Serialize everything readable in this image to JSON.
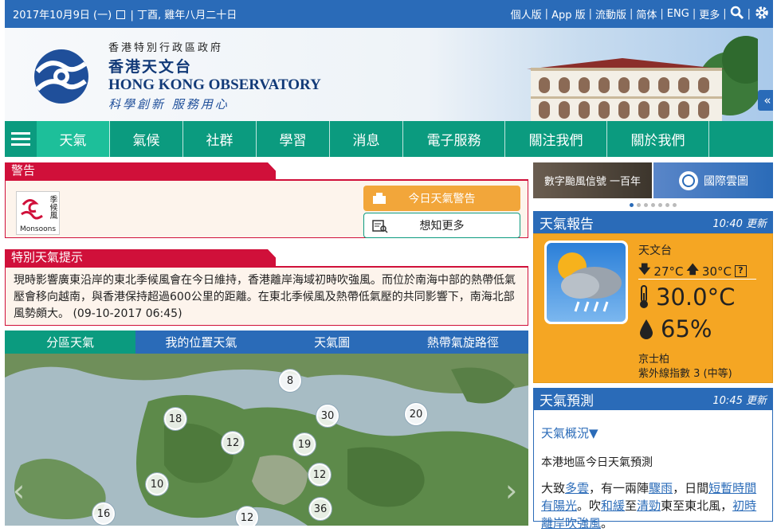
{
  "topbar": {
    "date": "2017年10月9日 (一)",
    "lunar": "| 丁酉, 雞年八月二十日",
    "links": [
      "個人版",
      "App 版",
      "流動版",
      "简体",
      "ENG",
      "更多"
    ],
    "separators": [
      "|",
      "|",
      "|",
      "|",
      "|",
      "|",
      "|"
    ],
    "search_icon": "search-icon",
    "settings_icon": "gear-icon"
  },
  "brand": {
    "gov": "香港特別行政區政府",
    "name_zh": "香港天文台",
    "name_en": "HONG KONG OBSERVATORY",
    "slogan": "科學創新 服務用心",
    "collapse": "«"
  },
  "nav": {
    "items": [
      "天氣",
      "氣候",
      "社群",
      "學習",
      "消息",
      "電子服務",
      "關注我們",
      "關於我們"
    ],
    "active_index": 0
  },
  "warnings": {
    "title": "警告",
    "monsoon_zh": "季候風",
    "monsoon_en": "Monsoons",
    "btn_today": "今日天氣警告",
    "btn_more": "想知更多"
  },
  "tips": {
    "title": "特別天氣提示",
    "text": "現時影響廣東沿岸的東北季候風會在今日維持，香港離岸海域初時吹強風。而位於南海中部的熱帶低氣壓會移向越南，與香港保持超過600公里的距離。在東北季候風及熱帶低氣壓的共同影響下，南海北部風勢頗大。 (09-10-2017 06:45)"
  },
  "map": {
    "tabs": [
      "分區天氣",
      "我的位置天氣",
      "天氣圖",
      "熱帶氣旋路徑"
    ],
    "active_tab": 0,
    "stations": [
      "8",
      "18",
      "30",
      "20",
      "12",
      "19",
      "12",
      "10",
      "36",
      "16",
      "12"
    ],
    "prev": "‹",
    "next": "›"
  },
  "promo": {
    "p1": "數字颱風信號 一百年",
    "p2": "國際雲圖",
    "dots": 7,
    "active_dot": 0
  },
  "report": {
    "title": "天氣報告",
    "updated": "10:40 更新",
    "station": "天文台",
    "min": "27°C",
    "max": "30°C",
    "help": "?",
    "temperature": "30.0°C",
    "humidity": "65%",
    "uv_station": "京士柏",
    "uv_index": "紫外線指數 3 (中等)"
  },
  "forecast": {
    "title": "天氣預測",
    "updated": "10:45 更新",
    "overview": "天氣概況▼",
    "today": "本港地區今日天氣預測",
    "p1": "大致",
    "l1": "多雲",
    "p2": "，有一兩陣",
    "l2": "驟雨",
    "p3": "，日間",
    "l3": "短暫時間有陽光",
    "p4": "。吹",
    "l4": "和緩",
    "p5": "至",
    "l5": "清勁",
    "p6": "東至東北風，",
    "l6": "初時離岸吹強風",
    "p7": "。"
  },
  "colors": {
    "topbar": "#2a6bb8",
    "nav": "#0b9b7f",
    "nav_active": "#1dbf9a",
    "warning_red": "#d0103a",
    "report_orange": "#f5a623"
  }
}
